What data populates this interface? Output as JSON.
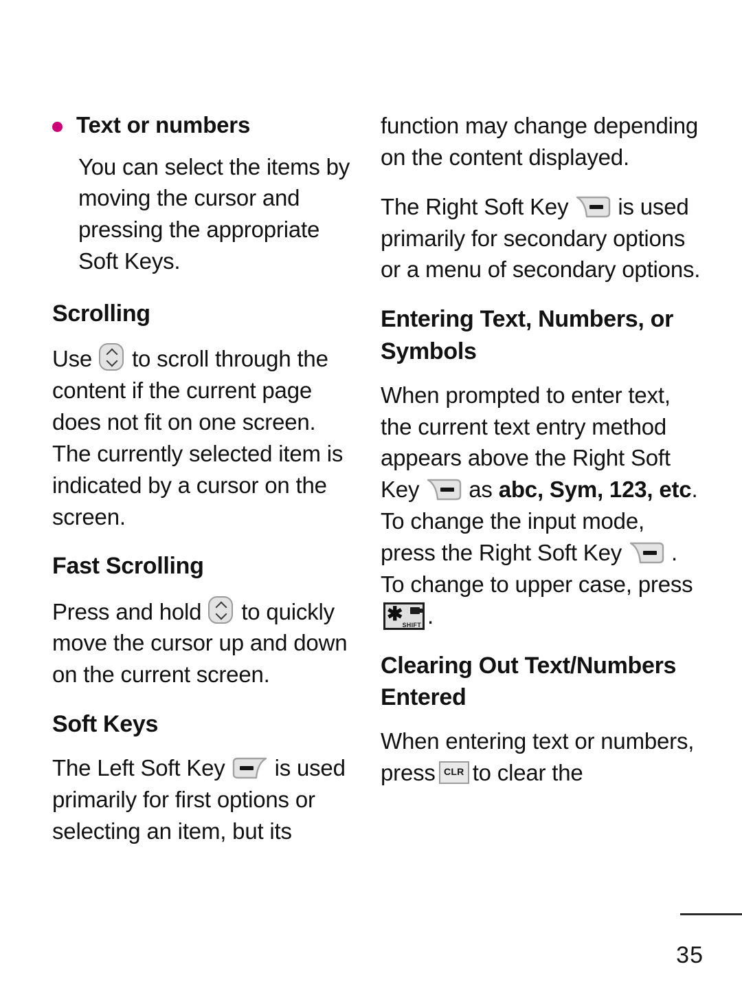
{
  "page": {
    "number": "35",
    "bullet_color": "#cc0077"
  },
  "left_column": {
    "bullet_item": {
      "title": "Text or numbers",
      "body": "You can select the items by moving the cursor and pressing the appropriate Soft Keys."
    },
    "scrolling": {
      "heading": "Scrolling",
      "text_before_icon": "Use",
      "icon": "navigation-up-down-key",
      "text_after_icon": "to scroll through the content if the current page does not fit on one screen. The currently selected item is indicated by a cursor on the screen."
    },
    "fast_scrolling": {
      "heading": "Fast Scrolling",
      "text_before_icon": "Press and hold",
      "icon": "navigation-up-down-key",
      "text_after_icon": "to quickly move the cursor up and down on the current screen."
    },
    "soft_keys": {
      "heading": "Soft Keys",
      "text_before_icon": "The Left Soft Key",
      "icon": "left-soft-key",
      "text_after_icon": "is used primarily for first options or selecting an item, but its"
    }
  },
  "right_column": {
    "continuation": "function may change depending on the content displayed.",
    "right_soft_key_para": {
      "text_before_icon": "The Right Soft Key",
      "icon": "right-soft-key",
      "text_after_icon": "is used primarily for secondary options or a menu of secondary options."
    },
    "entering": {
      "heading": "Entering Text, Numbers, or Symbols",
      "part1": "When prompted to enter text, the current text entry method appears above the Right Soft",
      "key_word": "Key",
      "icon1": "right-soft-key",
      "as_word": "as",
      "modes_bold": "abc, Sym, 123,",
      "etc_bold": "etc",
      "part2": ". To change the input mode, press the Right Soft Key",
      "icon2": "right-soft-key",
      "part3": ". To change to upper case, press",
      "icon3": "shift-key",
      "part4": "."
    },
    "clearing": {
      "heading": "Clearing Out Text/Numbers Entered",
      "text_before_icon": "When entering text or numbers, press",
      "icon": "clr-key",
      "icon_label": "CLR",
      "text_after_icon": "to clear the"
    }
  }
}
